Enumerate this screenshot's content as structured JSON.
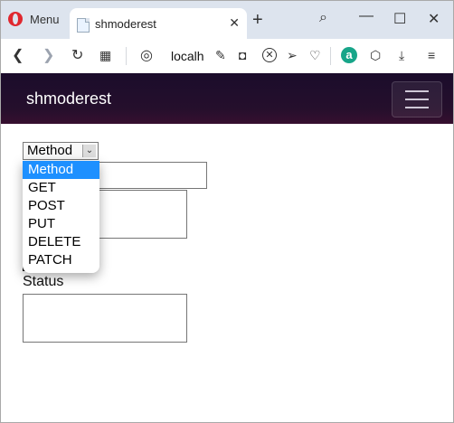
{
  "browser": {
    "menu_label": "Menu",
    "tab": {
      "title": "shmoderest"
    },
    "address": {
      "url": "localh"
    }
  },
  "icons": {
    "menu": "opera-logo-icon",
    "tab_page": "page-icon",
    "tab_close": "close-icon",
    "new_tab": "plus-icon",
    "search": "search-icon",
    "minimize": "minimize-icon",
    "maximize": "maximize-icon",
    "close": "close-icon",
    "back": "back-arrow-icon",
    "forward": "forward-arrow-icon",
    "reload": "reload-icon",
    "speed_dial": "grid-icon",
    "security": "globe-icon",
    "edit": "edit-icon",
    "camera": "camera-icon",
    "block": "block-icon",
    "send": "send-icon",
    "heart": "heart-icon",
    "account": "account-icon",
    "cube": "cube-icon",
    "download": "download-icon",
    "settings": "settings-icon"
  },
  "app": {
    "brand": "shmoderest",
    "method_select": {
      "value": "Method",
      "options": [
        "Method",
        "GET",
        "POST",
        "PUT",
        "DELETE",
        "PATCH"
      ]
    },
    "status_label": "Status"
  },
  "colors": {
    "navbar_top": "#1b0c2b",
    "navbar_bottom": "#360f2f",
    "selected_option": "#1e90ff"
  }
}
